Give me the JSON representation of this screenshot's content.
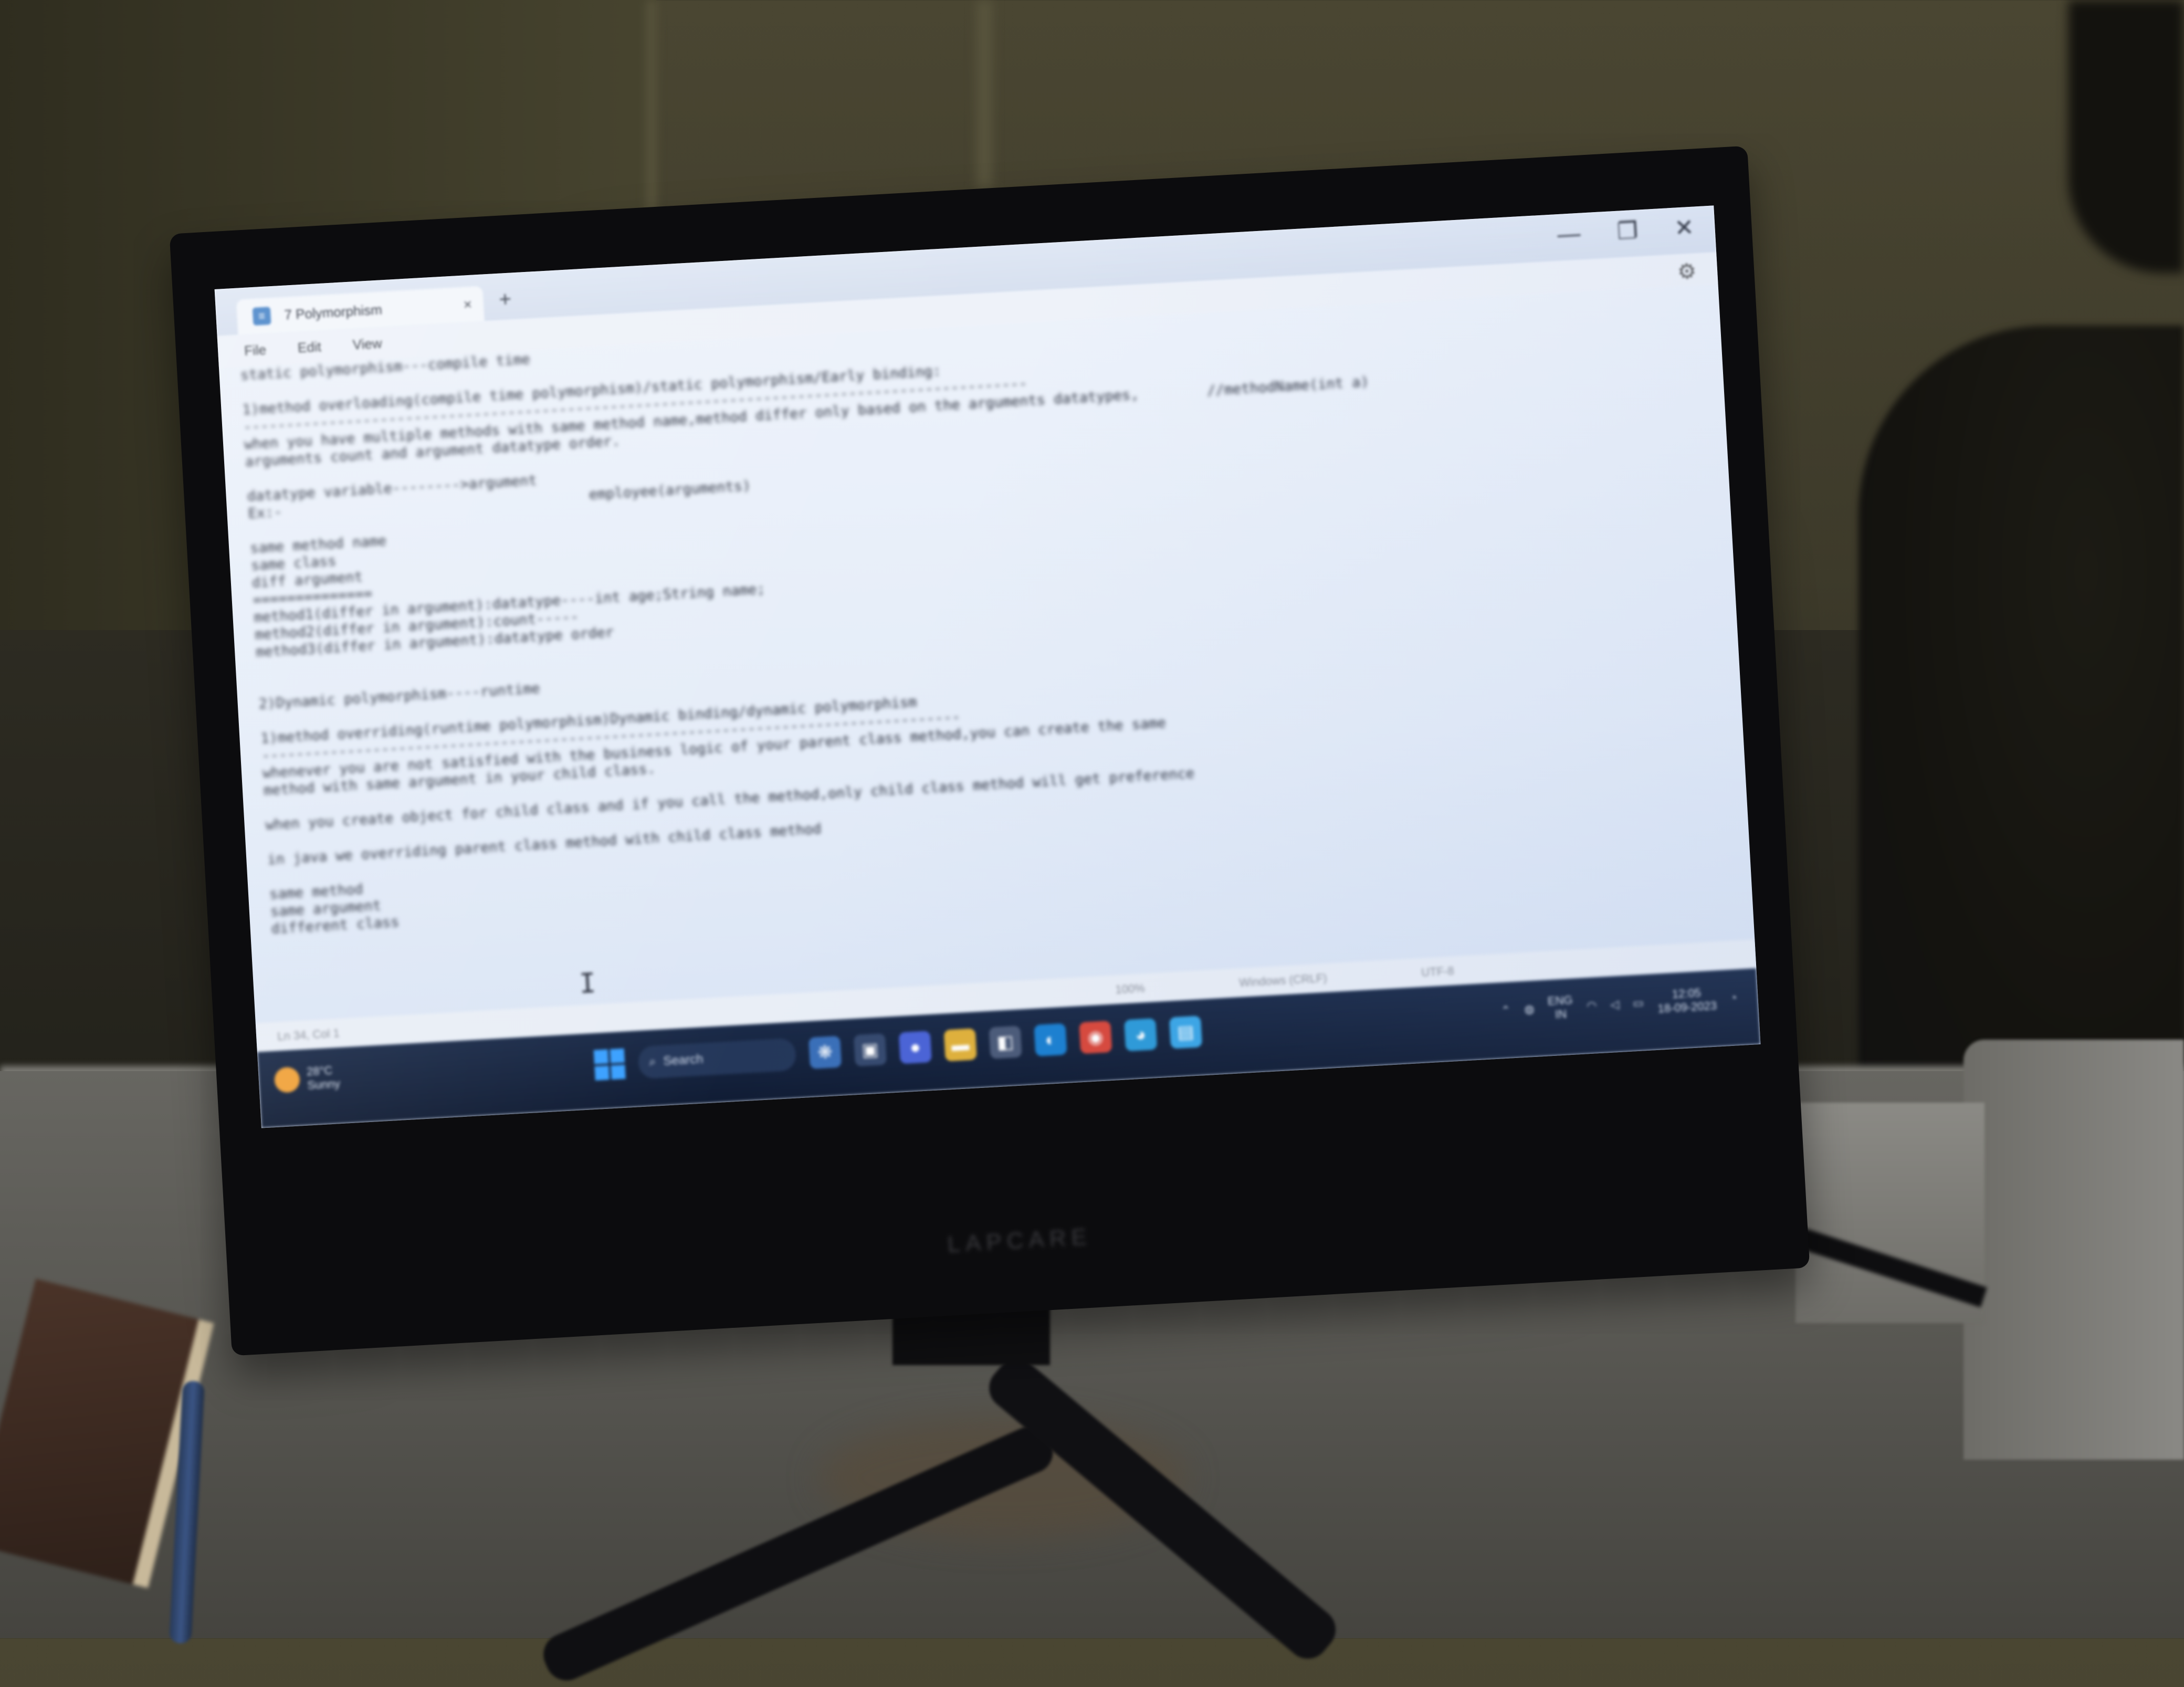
{
  "window": {
    "tab_title": "7 Polymorphism",
    "tab_close": "×",
    "new_tab": "+",
    "app_icon_glyph": "≡",
    "controls": {
      "minimize": "—",
      "maximize": "❐",
      "close": "✕"
    }
  },
  "menu": {
    "file": "File",
    "edit": "Edit",
    "view": "View"
  },
  "editor": {
    "lines": [
      "static polymorphism---compile time",
      "",
      "1)method overloading(compile time polymorphism)/static polymorphism/Early binding:",
      "--------------------------------------------------------------------------------------------",
      "when you have multiple methods with same method name,method differ only based on the arguments datatypes,        //methodName(int a)",
      "arguments count and argument datatype order.",
      "",
      "datatype variable-------->argument",
      "Ex:-                                    employee(arguments)",
      "",
      "same method name",
      "same class",
      "diff argument",
      "==============",
      "method1(differ in argument):datatype----int age;String name;",
      "method2(differ in argument):count-----",
      "method3(differ in argument):datatype order",
      "",
      "",
      "2)Dynamic polymorphism----runtime",
      "",
      "1)method overriding(runtime polymorphism)Dynamic binding/dynamic polymorphism",
      "----------------------------------------------------------------------------------",
      "whenever you are not satisfied with the business logic of your parent class method,you can create the same",
      "method with same argument in your child class.",
      "",
      "when you create object for child class and if you call the method,only child class method will get preference",
      "",
      "in java we overriding parent class method with child class method",
      "",
      "same method",
      "same argument",
      "different class"
    ],
    "cursor": "I"
  },
  "status": {
    "position": "Ln 34, Col 1",
    "zoom": "100%",
    "line_ending": "Windows (CRLF)",
    "encoding": "UTF-8"
  },
  "taskbar": {
    "weather_temp": "28°C",
    "weather_desc": "Sunny",
    "search_placeholder": "Search",
    "language": "ENG",
    "region": "IN",
    "time": "12:05",
    "date": "18-09-2023"
  },
  "monitor": {
    "brand": "LAPCARE"
  }
}
